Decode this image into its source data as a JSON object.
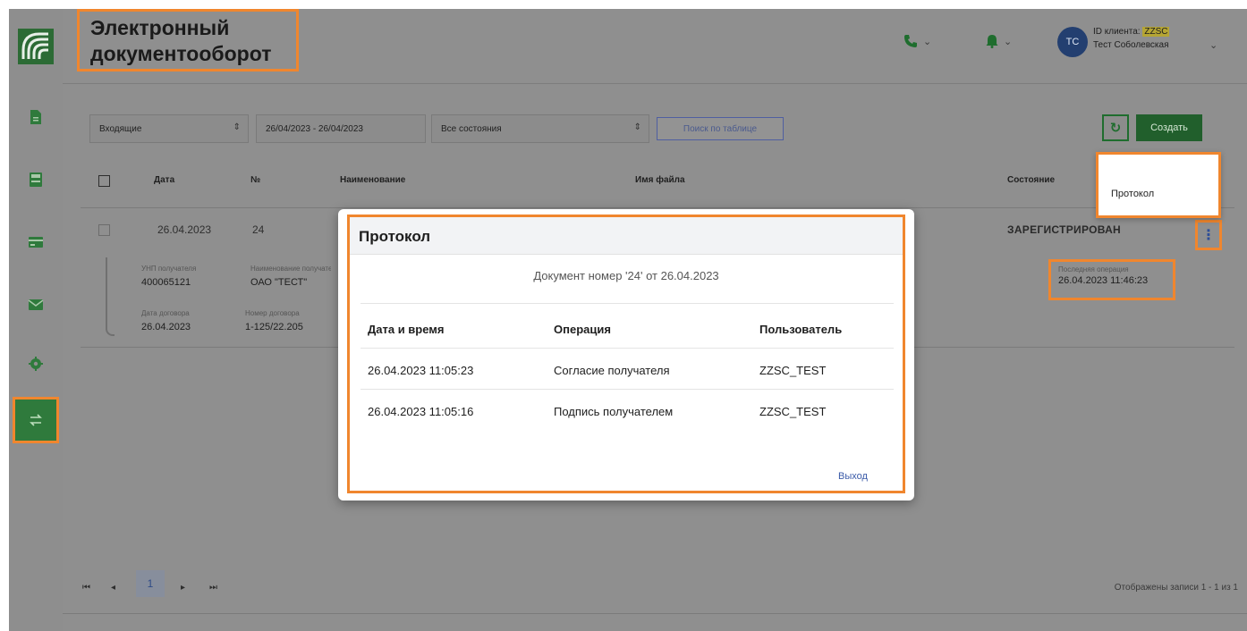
{
  "header": {
    "title": "Электронный документооборот",
    "client_id_label": "ID клиента:",
    "client_id_value": "ZZSC",
    "user_name": "Тест Соболевская",
    "avatar_initials": "ТС"
  },
  "filters": {
    "direction": "Входящие",
    "date_range": "26/04/2023 - 26/04/2023",
    "state": "Все состояния",
    "search_label": "Поиск по таблице",
    "create_label": "Создать"
  },
  "table": {
    "headers": {
      "date": "Дата",
      "number": "№",
      "name": "Наименование",
      "filename": "Имя файла",
      "state": "Состояние"
    },
    "row": {
      "date": "26.04.2023",
      "number": "24",
      "state": "ЗАРЕГИСТРИРОВАН",
      "details": {
        "unp_label": "УНП получателя",
        "unp_value": "400065121",
        "recipient_label": "Наименование получателя",
        "recipient_value": "ОАО \"ТЕСТ\"",
        "contract_date_label": "Дата договора",
        "contract_date_value": "26.04.2023",
        "contract_no_label": "Номер договора",
        "contract_no_value": "1-125/22.205",
        "last_op_label": "Последняя операция",
        "last_op_value": "26.04.2023 11:46:23"
      }
    }
  },
  "context_menu": {
    "items": [
      "Протокол"
    ]
  },
  "pagination": {
    "current_page": "1",
    "records": "Отображены записи 1 - 1 из 1"
  },
  "modal": {
    "title": "Протокол",
    "subtitle": "Документ номер '24' от 26.04.2023",
    "columns": [
      "Дата и время",
      "Операция",
      "Пользователь"
    ],
    "rows": [
      [
        "26.04.2023 11:05:23",
        "Согласие получателя",
        "ZZSC_TEST"
      ],
      [
        "26.04.2023 11:05:16",
        "Подпись получателем",
        "ZZSC_TEST"
      ]
    ],
    "exit_label": "Выход"
  },
  "colors": {
    "accent_green": "#2f7a3c",
    "highlight_orange": "#f0862e",
    "link_blue": "#3a5aa8"
  }
}
